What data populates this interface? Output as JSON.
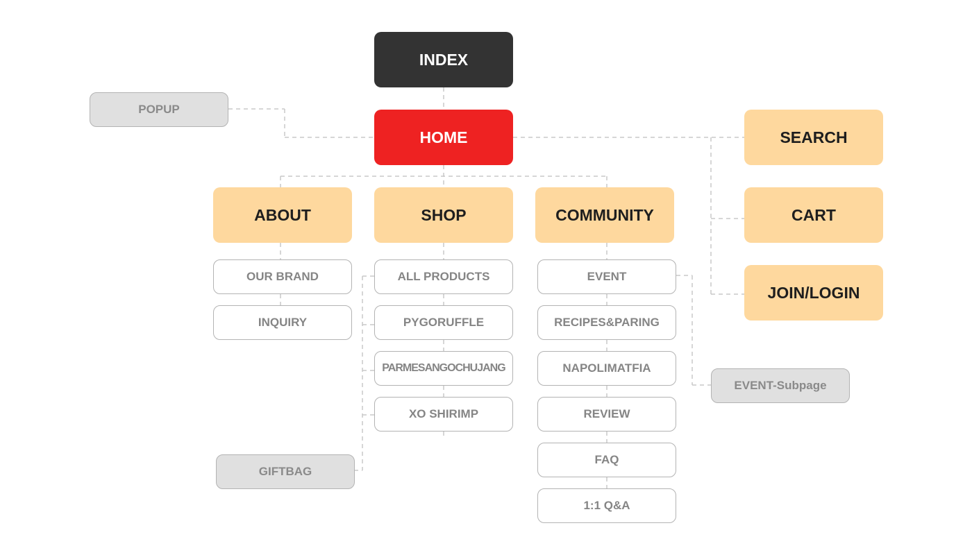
{
  "nodes": {
    "index": "INDEX",
    "home": "HOME",
    "popup": "POPUP",
    "search": "SEARCH",
    "cart": "CART",
    "join_login": "JOIN/LOGIN",
    "about": "ABOUT",
    "shop": "SHOP",
    "community": "COMMUNITY",
    "about_children": [
      "OUR BRAND",
      "INQUIRY"
    ],
    "shop_children": [
      "ALL PRODUCTS",
      "PYGORUFFLE",
      "PARMESANGOCHUJANG",
      "XO SHIRIMP"
    ],
    "giftbag": "GIFTBAG",
    "community_children": [
      "EVENT",
      "RECIPES&PARING",
      "NAPOLIMATFIA",
      "REVIEW",
      "FAQ",
      "1:1 Q&A"
    ],
    "event_subpage": "EVENT-Subpage"
  },
  "colors": {
    "index_bg": "#333333",
    "home_bg": "#ee2222",
    "main_menu_bg": "#fed89e",
    "extra_page_bg": "#e0e0e0",
    "sub_page_border": "#b3b3b3",
    "connector": "#c9c9c9"
  }
}
